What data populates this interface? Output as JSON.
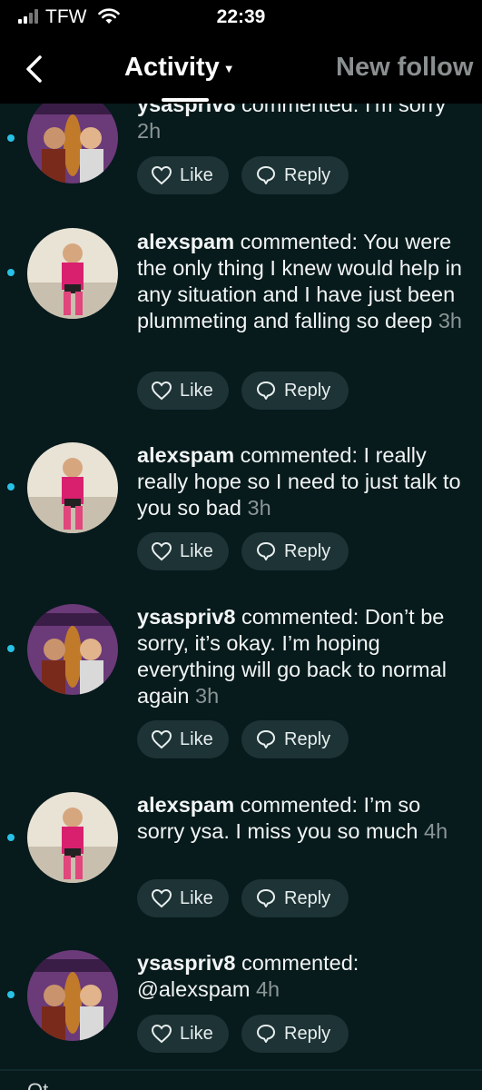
{
  "status_bar": {
    "carrier": "TFW",
    "time": "22:39"
  },
  "header": {
    "active_tab": "Activity",
    "other_tab": "New follow"
  },
  "feed": {
    "items": [
      {
        "user": "ysaspriv8",
        "action": "commented:",
        "text": "I'm sorry",
        "time": "2h",
        "avatar": "avatar-ysaspriv8"
      },
      {
        "user": "alexspam",
        "action": "commented:",
        "text": "You were the only thing I knew would help in any situation and I have just been plummeting and falling so deep",
        "time": "3h",
        "avatar": "avatar-alexspam"
      },
      {
        "user": "alexspam",
        "action": "commented:",
        "text": "I really really hope so I need to just talk to you so bad",
        "time": "3h",
        "avatar": "avatar-alexspam"
      },
      {
        "user": "ysaspriv8",
        "action": "commented:",
        "text": "Don’t be sorry, it’s okay. I’m hoping everything will go back to normal again",
        "time": "3h",
        "avatar": "avatar-ysaspriv8"
      },
      {
        "user": "alexspam",
        "action": "commented:",
        "text": "I’m so sorry ysa. I miss you so much",
        "time": "4h",
        "avatar": "avatar-alexspam"
      },
      {
        "user": "ysaspriv8",
        "action": "commented:",
        "text": "@alexspam",
        "time": "4h",
        "avatar": "avatar-ysaspriv8"
      }
    ],
    "like_label": "Like",
    "reply_label": "Reply",
    "next_section_peek": "Ot"
  },
  "colors": {
    "background": "#071a1c",
    "unread_dot": "#27c2e6",
    "button_bg": "#1d3336",
    "timestamp": "#8b9596"
  }
}
